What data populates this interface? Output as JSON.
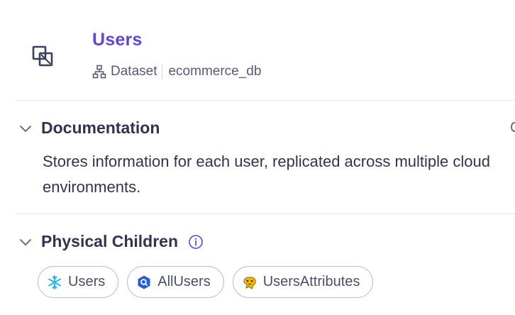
{
  "entity": {
    "title": "Users",
    "type_label": "Dataset",
    "database": "ecommerce_db"
  },
  "documentation": {
    "heading": "Documentation",
    "text": "Stores information for each user, replicated across multiple cloud environments."
  },
  "physical_children": {
    "heading": "Physical Children",
    "items": [
      {
        "label": "Users",
        "icon": "snowflake-icon",
        "color": "#29b5e8"
      },
      {
        "label": "AllUsers",
        "icon": "bigquery-icon",
        "color": "#2a5bd7"
      },
      {
        "label": "UsersAttributes",
        "icon": "hive-icon",
        "color": "#f2b705"
      }
    ]
  },
  "colors": {
    "accent": "#6247d6",
    "text": "#2f3452",
    "muted": "#565b73"
  }
}
